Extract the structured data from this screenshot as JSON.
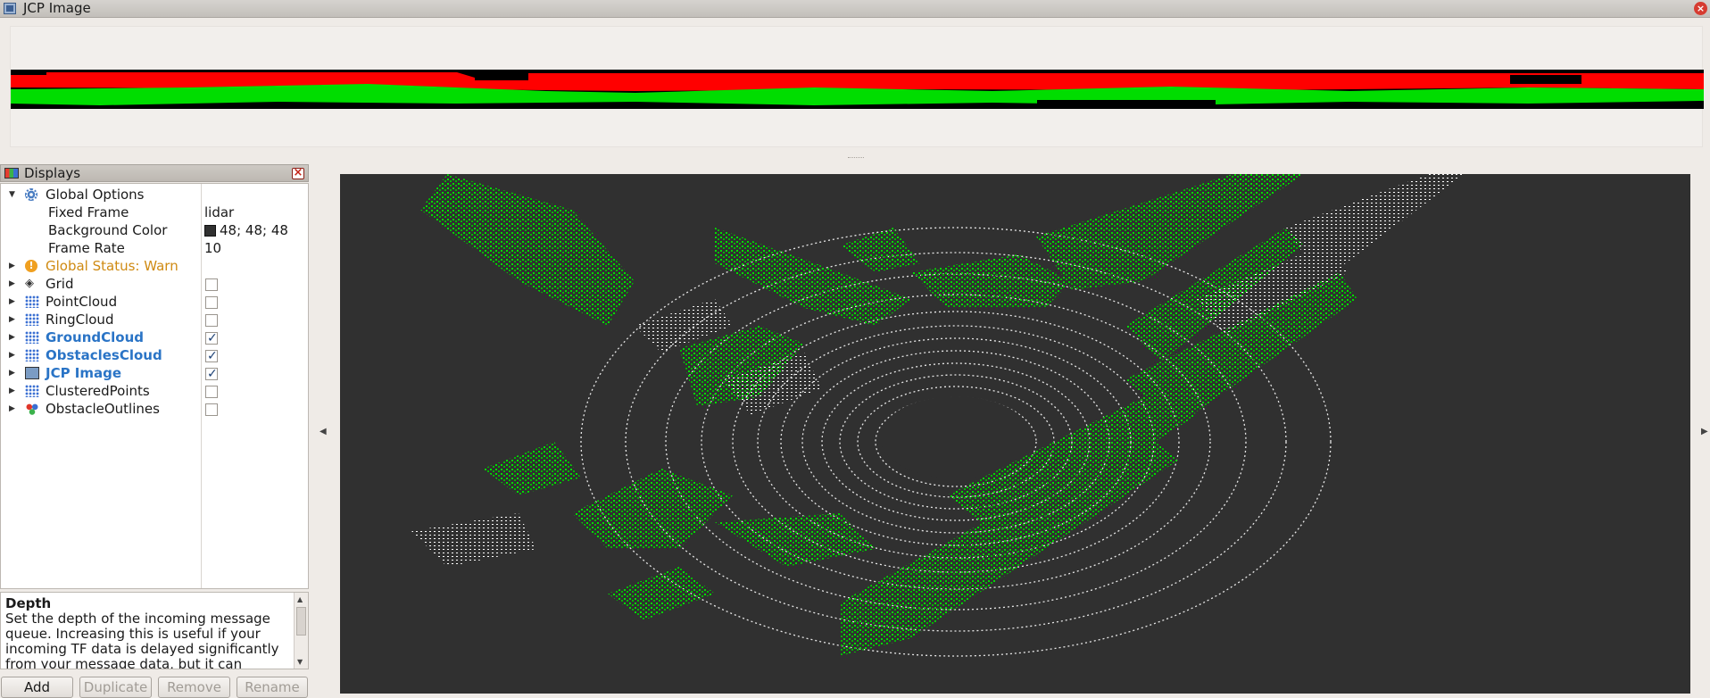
{
  "window": {
    "title": "JCP Image"
  },
  "displays": {
    "title": "Displays",
    "rows": [
      {
        "label": "Global Options",
        "value": ""
      },
      {
        "label": "Fixed Frame",
        "value": "lidar"
      },
      {
        "label": "Background Color",
        "value": "48; 48; 48"
      },
      {
        "label": "Frame Rate",
        "value": "10"
      },
      {
        "label": "Global Status: Warn",
        "value": ""
      },
      {
        "label": "Grid",
        "checked": false
      },
      {
        "label": "PointCloud",
        "checked": false
      },
      {
        "label": "RingCloud",
        "checked": false
      },
      {
        "label": "GroundCloud",
        "checked": true
      },
      {
        "label": "ObstaclesCloud",
        "checked": true
      },
      {
        "label": "JCP Image",
        "checked": true
      },
      {
        "label": "ClusteredPoints",
        "checked": false
      },
      {
        "label": "ObstacleOutlines",
        "checked": false
      }
    ],
    "background_color": "#303030"
  },
  "help": {
    "title": "Depth",
    "text": "Set the depth of the incoming message queue. Increasing this is useful if your incoming TF data is delayed significantly from your message data, but it can"
  },
  "buttons": {
    "add": "Add",
    "duplicate": "Duplicate",
    "remove": "Remove",
    "rename": "Rename"
  },
  "colors": {
    "ground": "#00dd00",
    "obstacle": "#ff0000",
    "viewport_bg": "#303030",
    "accent": "#2a74c6",
    "warn": "#cf8a12"
  }
}
